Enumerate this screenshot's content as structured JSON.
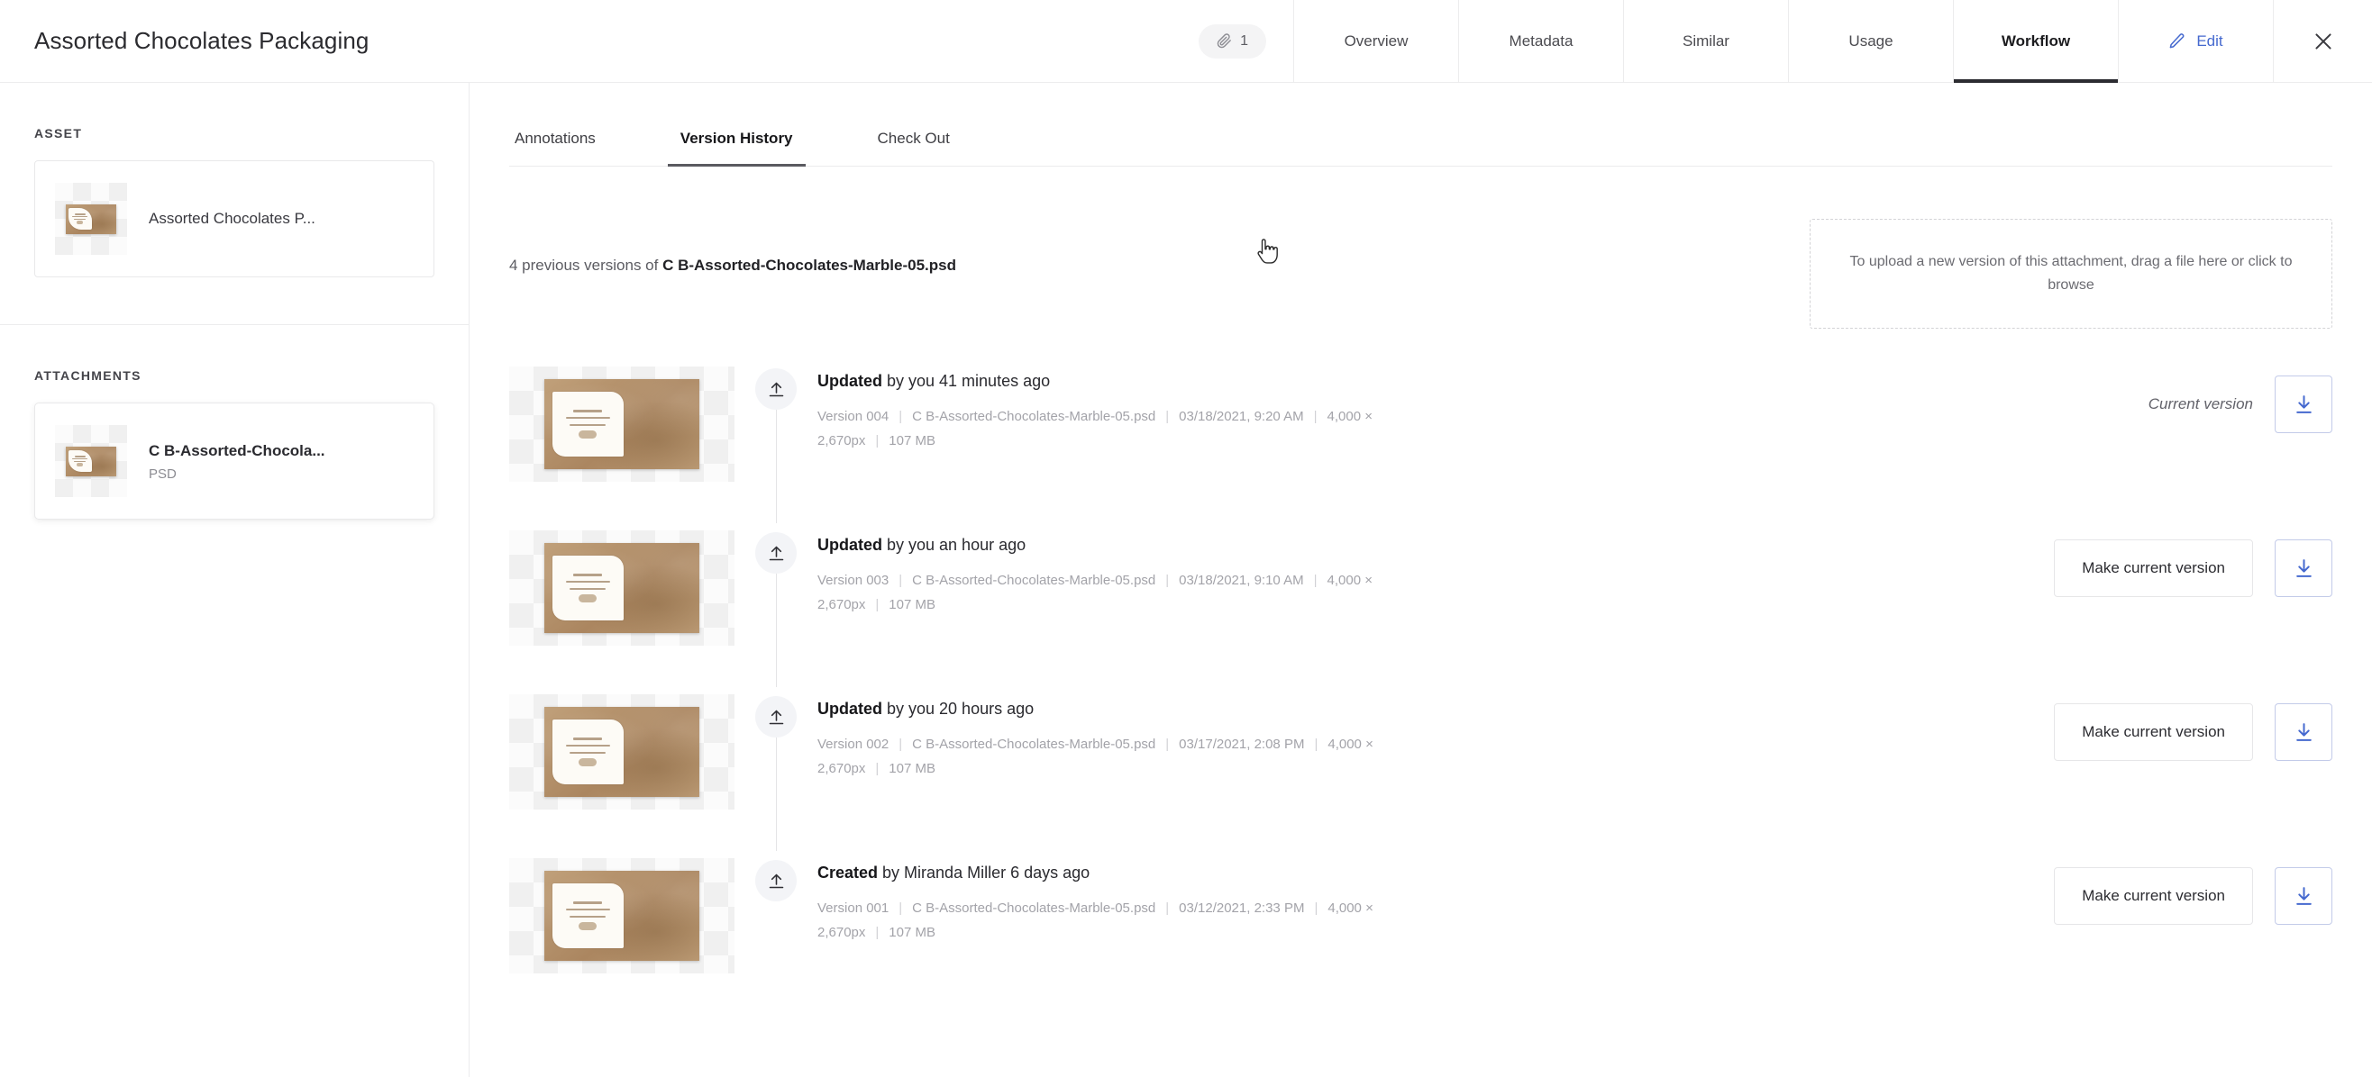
{
  "header": {
    "title": "Assorted Chocolates Packaging",
    "attachment_badge": {
      "icon": "paperclip-icon",
      "count": "1"
    },
    "tabs": [
      {
        "label": "Overview",
        "active": false
      },
      {
        "label": "Metadata",
        "active": false
      },
      {
        "label": "Similar",
        "active": false
      },
      {
        "label": "Usage",
        "active": false
      },
      {
        "label": "Workflow",
        "active": true
      }
    ],
    "edit_label": "Edit",
    "edit_icon": "pencil-icon",
    "close_icon": "close-icon",
    "accent_color": "#4569cf"
  },
  "sidebar": {
    "asset_label": "ASSET",
    "asset_name": "Assorted Chocolates P...",
    "attachments_label": "ATTACHMENTS",
    "attachment_name": "C B-Assorted-Chocola...",
    "attachment_type": "PSD"
  },
  "main": {
    "subtabs": [
      {
        "label": "Annotations",
        "active": false
      },
      {
        "label": "Version History",
        "active": true
      },
      {
        "label": "Check Out",
        "active": false
      }
    ],
    "previous_versions_prefix": "4 previous versions of ",
    "previous_versions_filename": "C B-Assorted-Chocolates-Marble-05.psd",
    "dropzone_text": "To upload a new version of this attachment, drag a file here or click to browse",
    "current_version_label": "Current version",
    "make_current_label": "Make current version",
    "download_icon": "download-icon",
    "upload_icon": "upload-icon",
    "versions": [
      {
        "action": "Updated",
        "actor": " by you 41 minutes ago",
        "version": "Version 004",
        "filename": "C B-Assorted-Chocolates-Marble-05.psd",
        "timestamp": "03/18/2021, 9:20 AM",
        "dimensions": "4,000 × 2,670px",
        "size": "107 MB",
        "is_current": true
      },
      {
        "action": "Updated",
        "actor": " by you an hour ago",
        "version": "Version 003",
        "filename": "C B-Assorted-Chocolates-Marble-05.psd",
        "timestamp": "03/18/2021, 9:10 AM",
        "dimensions": "4,000 × 2,670px",
        "size": "107 MB",
        "is_current": false
      },
      {
        "action": "Updated",
        "actor": " by you 20 hours ago",
        "version": "Version 002",
        "filename": "C B-Assorted-Chocolates-Marble-05.psd",
        "timestamp": "03/17/2021, 2:08 PM",
        "dimensions": "4,000 × 2,670px",
        "size": "107 MB",
        "is_current": false
      },
      {
        "action": "Created",
        "actor": " by Miranda Miller 6 days ago",
        "version": "Version 001",
        "filename": "C B-Assorted-Chocolates-Marble-05.psd",
        "timestamp": "03/12/2021, 2:33 PM",
        "dimensions": "4,000 × 2,670px",
        "size": "107 MB",
        "is_current": false
      }
    ]
  }
}
